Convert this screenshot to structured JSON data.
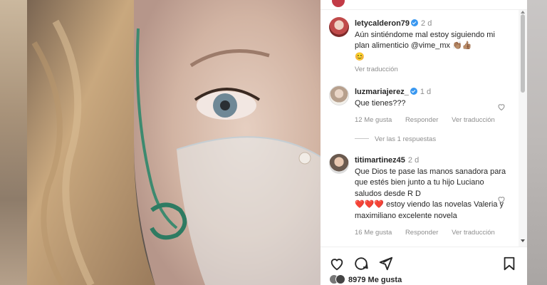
{
  "comments": [
    {
      "username": "letycalderon79",
      "verified": true,
      "time": "2 d",
      "text": "Aún sintiéndome mal estoy siguiendo mi plan alimenticio @vime_mx 👏🏽👍🏽",
      "emoji": "😊",
      "translate": "Ver traducción"
    },
    {
      "username": "luzmariajerez_",
      "verified": true,
      "time": "1 d",
      "text": "Que tienes???",
      "likes": "12 Me gusta",
      "reply": "Responder",
      "translate": "Ver traducción",
      "replies_label": "Ver las 1 respuestas"
    },
    {
      "username": "titimartinez45",
      "verified": false,
      "time": "2 d",
      "text": "Que Dios te pase las manos sanadora para que estés bien junto a tu hijo Luciano saludos desde R D",
      "hearts": "❤️❤️❤️",
      "text2": "estoy viendo las novelas Valeria y maximiliano excelente novela",
      "likes": "16 Me gusta",
      "reply": "Responder",
      "translate": "Ver traducción"
    }
  ],
  "likes_count": "8979 Me gusta",
  "icons": [
    "heart-icon",
    "comment-icon",
    "share-icon",
    "bookmark-icon"
  ],
  "colors": {
    "verified": "#3897f0",
    "text": "#262626",
    "muted": "#8e8e8e"
  }
}
